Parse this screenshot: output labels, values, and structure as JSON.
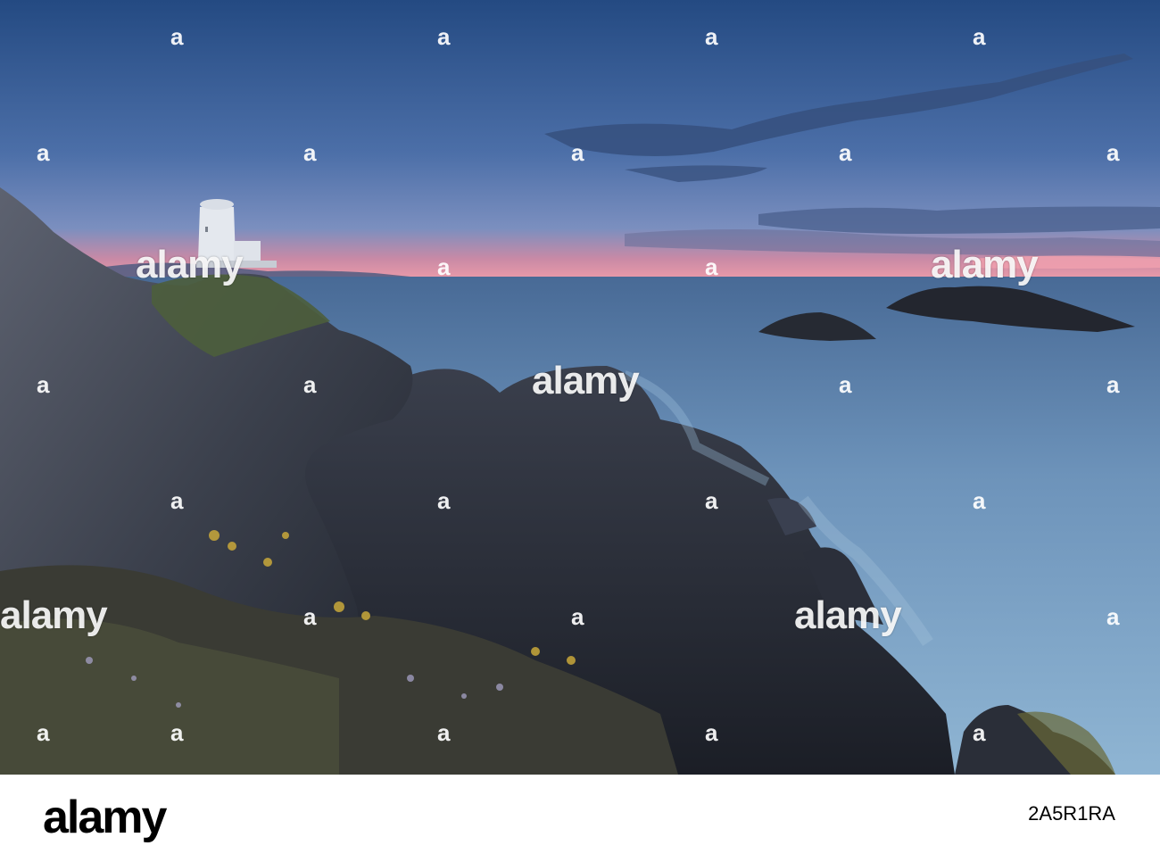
{
  "photo": {
    "subject": "Lighthouse on rocky coast at dusk",
    "colors": {
      "sky_top": "#2a4f86",
      "sky_mid": "#4f73ab",
      "horizon_glow": "#e48aa4",
      "sea": "#7fa6c8",
      "rock": "#2b2f3a"
    }
  },
  "watermark": {
    "text": "alamy",
    "icon": "alamy-a-icon"
  },
  "footer": {
    "logo": "alamy",
    "image_id": "2A5R1RA"
  }
}
